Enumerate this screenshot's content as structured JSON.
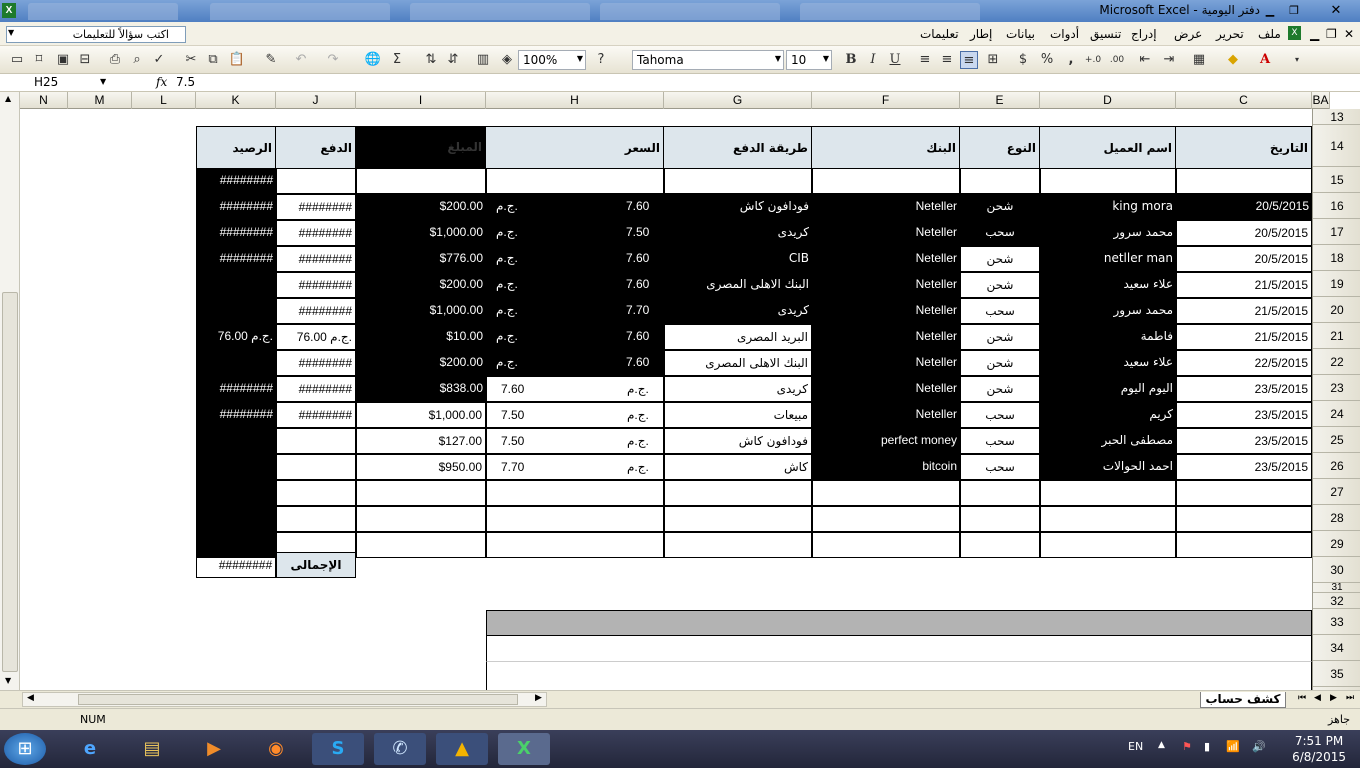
{
  "window": {
    "title": "Microsoft Excel - دفتر اليومية",
    "controls": [
      "close-icon",
      "maximize-icon",
      "minimize-icon"
    ]
  },
  "menu": {
    "help_placeholder": "اكتب سؤالاً للتعليمات",
    "items": [
      "ملف",
      "تحرير",
      "عرض",
      "إدراج",
      "تنسيق",
      "أدوات",
      "بيانات",
      "إطار",
      "تعليمات"
    ]
  },
  "toolbar": {
    "zoom": "100%",
    "font": "Tahoma",
    "font_size": "10",
    "bold": "B",
    "italic": "I",
    "underline": "U",
    "currency": "$",
    "percent": "%",
    "comma": ","
  },
  "formula_bar": {
    "name_box": "H25",
    "fx": "fx",
    "value": "7.5"
  },
  "columns": [
    "N",
    "M",
    "L",
    "K",
    "J",
    "I",
    "H",
    "G",
    "F",
    "E",
    "D",
    "C",
    "BA"
  ],
  "rows": [
    "13",
    "14",
    "15",
    "16",
    "17",
    "18",
    "19",
    "20",
    "21",
    "22",
    "23",
    "24",
    "25",
    "26",
    "27",
    "28",
    "29",
    "30",
    "31",
    "32",
    "33",
    "34",
    "35"
  ],
  "headers": {
    "balance": "الرصيد",
    "payment": "الدفع",
    "amount": "المبلغ",
    "price": "السعر",
    "pay_method": "طريقة الدفع",
    "bank": "البنك",
    "type": "النوع",
    "client": "اسم العميل",
    "date": "التاريخ"
  },
  "data_rows": [
    {
      "k": "########",
      "j": "########",
      "i": "$200.00",
      "hcur": "ج.م.",
      "h": "7.60",
      "g": "فودافون كاش",
      "f": "Neteller",
      "e": "شحن",
      "d": "king mora",
      "c": "20/5/2015"
    },
    {
      "k": "########",
      "j": "########",
      "i": "$1,000.00",
      "hcur": "ج.م.",
      "h": "7.50",
      "g": "كريدى",
      "f": "Neteller",
      "e": "سحب",
      "d": "محمد سرور",
      "c": "20/5/2015"
    },
    {
      "k": "########",
      "j": "########",
      "i": "$776.00",
      "hcur": "ج.م.",
      "h": "7.60",
      "g": "CIB",
      "f": "Neteller",
      "e": "شحن",
      "d": "netller man",
      "c": "20/5/2015"
    },
    {
      "k": "",
      "j": "########",
      "i": "$200.00",
      "hcur": "ج.م.",
      "h": "7.60",
      "g": "البنك الاهلى المصرى",
      "f": "Neteller",
      "e": "شحن",
      "d": "علاء سعيد",
      "c": "21/5/2015"
    },
    {
      "k": "",
      "j": "########",
      "i": "$1,000.00",
      "hcur": "ج.م.",
      "h": "7.70",
      "g": "كريدى",
      "f": "Neteller",
      "e": "سحب",
      "d": "محمد سرور",
      "c": "21/5/2015"
    },
    {
      "k": "76.00 ج.م.",
      "j": "76.00 ج.م.",
      "i": "$10.00",
      "hcur": "ج.م.",
      "h": "7.60",
      "g": "البريد المصرى",
      "f": "Neteller",
      "e": "شحن",
      "d": "فاطمة",
      "c": "21/5/2015"
    },
    {
      "k": "",
      "j": "########",
      "i": "$200.00",
      "hcur": "ج.م.",
      "h": "7.60",
      "g": "البنك الاهلى المصرى",
      "f": "Neteller",
      "e": "شحن",
      "d": "علاء سعيد",
      "c": "22/5/2015"
    },
    {
      "k": "########",
      "j": "########",
      "i": "$838.00",
      "hcur": "ج.م.",
      "h": "7.60",
      "g": "كريدى",
      "f": "Neteller",
      "e": "شحن",
      "d": "اليوم اليوم",
      "c": "23/5/2015"
    },
    {
      "k": "########",
      "j": "########",
      "i": "$1,000.00",
      "hcur": "ج.م.",
      "h": "7.50",
      "g": "مبيعات",
      "f": "Neteller",
      "e": "سحب",
      "d": "كريم",
      "c": "23/5/2015"
    },
    {
      "k": "",
      "j": "",
      "i": "$127.00",
      "hcur": "ج.م.",
      "h": "7.50",
      "g": "فودافون كاش",
      "f": "perfect money",
      "e": "سحب",
      "d": "مصطفى الحبر",
      "c": "23/5/2015"
    },
    {
      "k": "",
      "j": "",
      "i": "$950.00",
      "hcur": "ج.م.",
      "h": "7.70",
      "g": "كاش",
      "f": "bitcoin",
      "e": "سحب",
      "d": "احمد الحوالات",
      "c": "23/5/2015"
    }
  ],
  "total": {
    "label": "الإجمالى",
    "value": "########"
  },
  "k15": "########",
  "sheet_tab": "كشف حساب",
  "status": {
    "num": "NUM",
    "ready": "جاهز"
  },
  "taskbar": {
    "lang": "EN",
    "time": "7:51 PM",
    "date": "6/8/2015"
  }
}
